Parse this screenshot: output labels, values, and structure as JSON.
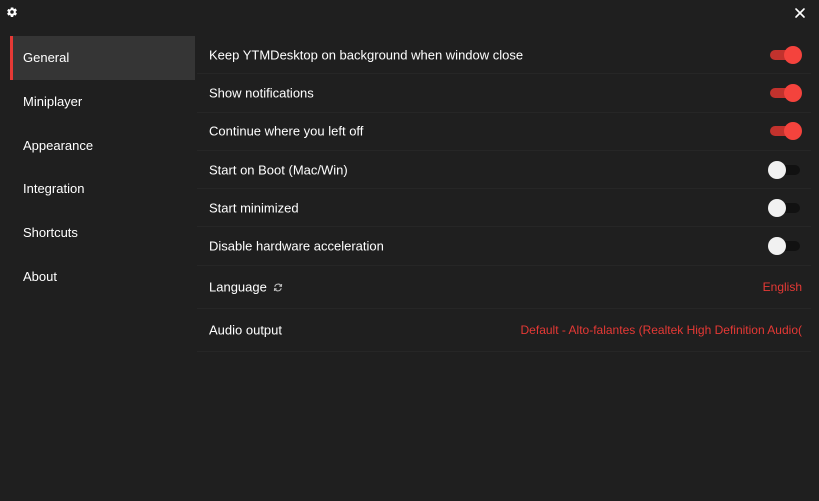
{
  "window": {
    "settings_icon": "gear-icon",
    "close_icon": "close-icon"
  },
  "sidebar": {
    "items": [
      {
        "label": "General",
        "active": true
      },
      {
        "label": "Miniplayer",
        "active": false
      },
      {
        "label": "Appearance",
        "active": false
      },
      {
        "label": "Integration",
        "active": false
      },
      {
        "label": "Shortcuts",
        "active": false
      },
      {
        "label": "About",
        "active": false
      }
    ]
  },
  "general": {
    "toggles": [
      {
        "label": "Keep YTMDesktop on background when window close",
        "on": true
      },
      {
        "label": "Show notifications",
        "on": true
      },
      {
        "label": "Continue where you left off",
        "on": true
      },
      {
        "label": "Start on Boot (Mac/Win)",
        "on": false
      },
      {
        "label": "Start minimized",
        "on": false
      },
      {
        "label": "Disable hardware acceleration",
        "on": false
      }
    ],
    "language": {
      "label": "Language",
      "value": "English",
      "refresh_icon": "refresh-icon"
    },
    "audio_output": {
      "label": "Audio output",
      "value": "Default - Alto-falantes (Realtek High Definition Audio("
    }
  },
  "colors": {
    "accent": "#e53935",
    "background": "#1f1f1f",
    "sidebar_active": "#353535"
  }
}
